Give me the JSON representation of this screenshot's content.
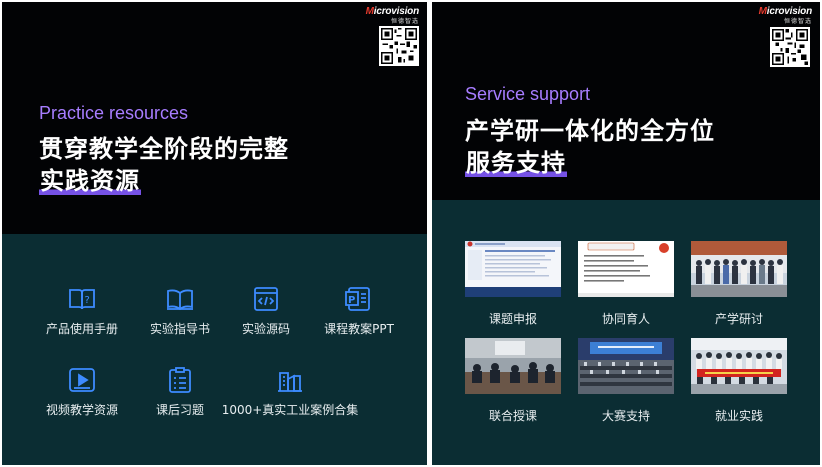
{
  "brand": {
    "name": "Microvision",
    "cn": "恒德智选"
  },
  "left": {
    "en_title": "Practice resources",
    "cn_line1": "贯穿教学全阶段的完整",
    "cn_line2": "实践资源",
    "items": [
      {
        "label": "产品使用手册",
        "icon": "manual-book-icon"
      },
      {
        "label": "实验指导书",
        "icon": "open-book-icon"
      },
      {
        "label": "实验源码",
        "icon": "code-icon"
      },
      {
        "label": "课程教案PPT",
        "icon": "ppt-icon"
      },
      {
        "label": "视频教学资源",
        "icon": "video-play-icon"
      },
      {
        "label": "课后习题",
        "icon": "clipboard-list-icon"
      },
      {
        "label": "1000+真实工业案例合集",
        "icon": "industrial-icon"
      }
    ]
  },
  "right": {
    "en_title": "Service support",
    "cn_line1": "产学研一体化的全方位",
    "cn_line2": "服务支持",
    "items": [
      {
        "label": "课题申报",
        "photo": "document-screenshot"
      },
      {
        "label": "协同育人",
        "photo": "document-slide"
      },
      {
        "label": "产学研讨",
        "photo": "group-photo"
      },
      {
        "label": "联合授课",
        "photo": "classroom-photo"
      },
      {
        "label": "大赛支持",
        "photo": "competition-hall-photo"
      },
      {
        "label": "就业实践",
        "photo": "banner-group-photo"
      }
    ]
  },
  "colors": {
    "accent_purple": "#a77dff",
    "icon_blue": "#3d8bff",
    "bottom_bg": "#0b2d33",
    "top_bg": "#020305"
  }
}
